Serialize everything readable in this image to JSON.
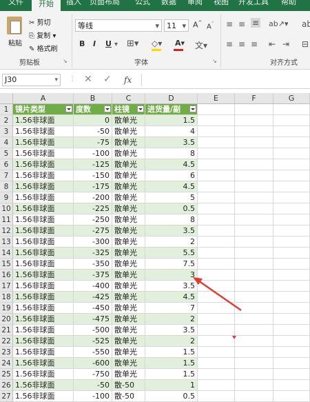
{
  "ribbon": {
    "tabs": [
      "文件",
      "开始",
      "插入",
      "页面布局",
      "公式",
      "数据",
      "审阅",
      "视图",
      "开发工具",
      "帮助"
    ],
    "clipboard": {
      "paste": "粘贴",
      "cut": "剪切",
      "copy": "复制",
      "format_painter": "格式刷",
      "group_label": "剪贴板"
    },
    "font": {
      "font_name": "等线",
      "font_size": "11",
      "bold": "B",
      "italic": "I",
      "underline": "U",
      "group_label": "字体"
    },
    "alignment": {
      "group_label": "对齐方式"
    }
  },
  "formula_bar": {
    "name_box": "J30",
    "fx": "fx",
    "formula": ""
  },
  "columns": [
    "A",
    "B",
    "C",
    "D",
    "E",
    "F",
    "G"
  ],
  "table": {
    "headers": [
      "镜片类型",
      "度数",
      "柱镜",
      "进货量/副"
    ],
    "rows": [
      [
        "1.56非球面",
        "0",
        "散单光",
        "1.5"
      ],
      [
        "1.56非球面",
        "-50",
        "散单光",
        "4"
      ],
      [
        "1.56非球面",
        "-75",
        "散单光",
        "3.5"
      ],
      [
        "1.56非球面",
        "-100",
        "散单光",
        "8"
      ],
      [
        "1.56非球面",
        "-125",
        "散单光",
        "4.5"
      ],
      [
        "1.56非球面",
        "-150",
        "散单光",
        "6"
      ],
      [
        "1.56非球面",
        "-175",
        "散单光",
        "4.5"
      ],
      [
        "1.56非球面",
        "-200",
        "散单光",
        "5"
      ],
      [
        "1.56非球面",
        "-225",
        "散单光",
        "0.5"
      ],
      [
        "1.56非球面",
        "-250",
        "散单光",
        "8"
      ],
      [
        "1.56非球面",
        "-275",
        "散单光",
        "3.5"
      ],
      [
        "1.56非球面",
        "-300",
        "散单光",
        "2"
      ],
      [
        "1.56非球面",
        "-325",
        "散单光",
        "5.5"
      ],
      [
        "1.56非球面",
        "-350",
        "散单光",
        "7.5"
      ],
      [
        "1.56非球面",
        "-375",
        "散单光",
        "3"
      ],
      [
        "1.56非球面",
        "-400",
        "散单光",
        "3.5"
      ],
      [
        "1.56非球面",
        "-425",
        "散单光",
        "4.5"
      ],
      [
        "1.56非球面",
        "-450",
        "散单光",
        "7"
      ],
      [
        "1.56非球面",
        "-475",
        "散单光",
        "2"
      ],
      [
        "1.56非球面",
        "-500",
        "散单光",
        "3.5"
      ],
      [
        "1.56非球面",
        "-525",
        "散单光",
        "2"
      ],
      [
        "1.56非球面",
        "-550",
        "散单光",
        "1.5"
      ],
      [
        "1.56非球面",
        "-600",
        "散单光",
        "1.5"
      ],
      [
        "1.56非球面",
        "-750",
        "散单光",
        "1.5"
      ],
      [
        "1.56非球面",
        "-50",
        "散-50",
        "1"
      ],
      [
        "1.56非球面",
        "-100",
        "散-50",
        "0.5"
      ]
    ]
  },
  "colors": {
    "excel_green": "#217346",
    "table_header": "#70ad47",
    "band": "#e2efda",
    "arrow": "#e03c31"
  }
}
